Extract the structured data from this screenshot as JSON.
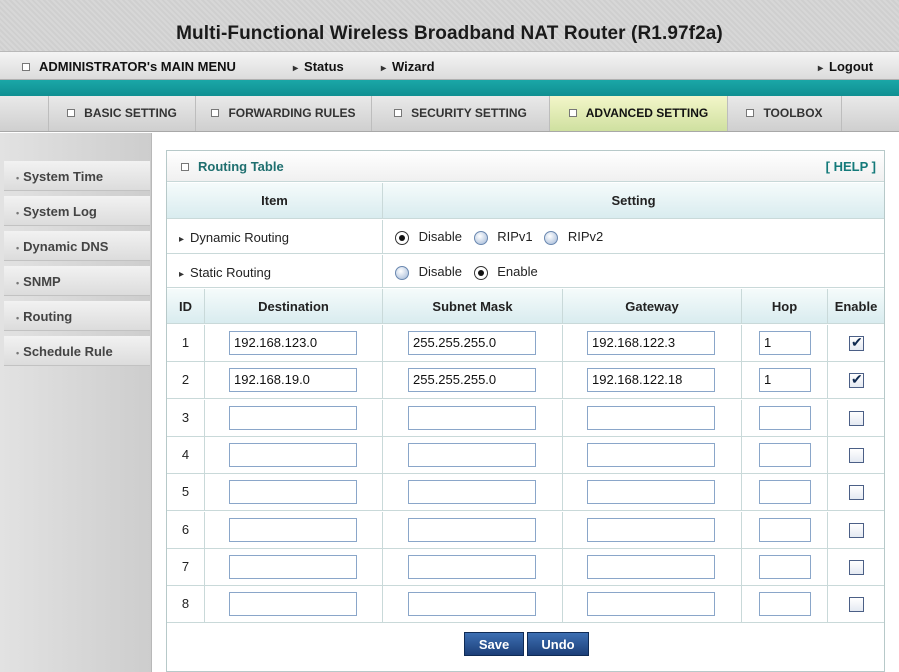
{
  "header": {
    "title": "Multi-Functional Wireless Broadband NAT Router (R1.97f2a)"
  },
  "menu": {
    "main": "ADMINISTRATOR's MAIN MENU",
    "status": "Status",
    "wizard": "Wizard",
    "logout": "Logout"
  },
  "tabs": [
    {
      "label": "BASIC SETTING"
    },
    {
      "label": "FORWARDING RULES"
    },
    {
      "label": "SECURITY SETTING"
    },
    {
      "label": "ADVANCED SETTING",
      "active": true
    },
    {
      "label": "TOOLBOX"
    }
  ],
  "sidebar": {
    "items": [
      {
        "label": "System Time"
      },
      {
        "label": "System Log"
      },
      {
        "label": "Dynamic DNS"
      },
      {
        "label": "SNMP"
      },
      {
        "label": "Routing",
        "active": true
      },
      {
        "label": "Schedule Rule"
      }
    ]
  },
  "panel": {
    "title": "Routing Table",
    "help": "[ HELP ]",
    "item_header": "Item",
    "setting_header": "Setting",
    "dynamic_routing": {
      "label": "Dynamic Routing",
      "options": [
        "Disable",
        "RIPv1",
        "RIPv2"
      ],
      "selected": "Disable"
    },
    "static_routing": {
      "label": "Static Routing",
      "options": [
        "Disable",
        "Enable"
      ],
      "selected": "Enable"
    },
    "columns": [
      "ID",
      "Destination",
      "Subnet Mask",
      "Gateway",
      "Hop",
      "Enable"
    ],
    "routes": [
      {
        "id": "1",
        "destination": "192.168.123.0",
        "mask": "255.255.255.0",
        "gateway": "192.168.122.3",
        "hop": "1",
        "enabled": true
      },
      {
        "id": "2",
        "destination": "192.168.19.0",
        "mask": "255.255.255.0",
        "gateway": "192.168.122.18",
        "hop": "1",
        "enabled": true
      },
      {
        "id": "3",
        "destination": "",
        "mask": "",
        "gateway": "",
        "hop": "",
        "enabled": false
      },
      {
        "id": "4",
        "destination": "",
        "mask": "",
        "gateway": "",
        "hop": "",
        "enabled": false
      },
      {
        "id": "5",
        "destination": "",
        "mask": "",
        "gateway": "",
        "hop": "",
        "enabled": false
      },
      {
        "id": "6",
        "destination": "",
        "mask": "",
        "gateway": "",
        "hop": "",
        "enabled": false
      },
      {
        "id": "7",
        "destination": "",
        "mask": "",
        "gateway": "",
        "hop": "",
        "enabled": false
      },
      {
        "id": "8",
        "destination": "",
        "mask": "",
        "gateway": "",
        "hop": "",
        "enabled": false
      }
    ],
    "save_label": "Save",
    "undo_label": "Undo"
  }
}
